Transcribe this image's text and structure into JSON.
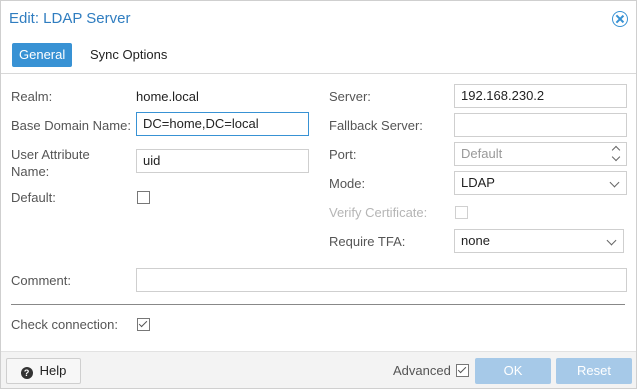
{
  "dialog": {
    "title": "Edit: LDAP Server",
    "close_icon": "close-icon"
  },
  "tabs": [
    {
      "label": "General",
      "active": true
    },
    {
      "label": "Sync Options",
      "active": false
    }
  ],
  "form": {
    "realm": {
      "label": "Realm:",
      "value": "home.local"
    },
    "base_domain": {
      "label": "Base Domain Name:",
      "value": "DC=home,DC=local"
    },
    "user_attr": {
      "label_line1": "User Attribute",
      "label_line2": "Name:",
      "value": "uid"
    },
    "default": {
      "label": "Default:",
      "checked": false
    },
    "server": {
      "label": "Server:",
      "value": "192.168.230.2"
    },
    "fallback": {
      "label": "Fallback Server:",
      "value": ""
    },
    "port": {
      "label": "Port:",
      "placeholder": "Default"
    },
    "mode": {
      "label": "Mode:",
      "value": "LDAP"
    },
    "verify_cert": {
      "label": "Verify Certificate:",
      "checked": false,
      "disabled": true
    },
    "require_tfa": {
      "label": "Require TFA:",
      "value": "none"
    },
    "comment": {
      "label": "Comment:",
      "value": ""
    },
    "check_connection": {
      "label": "Check connection:",
      "checked": true
    }
  },
  "footer": {
    "help_label": "Help",
    "help_icon": "question-circle-icon",
    "advanced_label": "Advanced",
    "advanced_checked": true,
    "ok_label": "OK",
    "reset_label": "Reset"
  },
  "colors": {
    "accent": "#3892d4",
    "title": "#2f7dc0",
    "disabled_button": "#a6c9e8"
  }
}
